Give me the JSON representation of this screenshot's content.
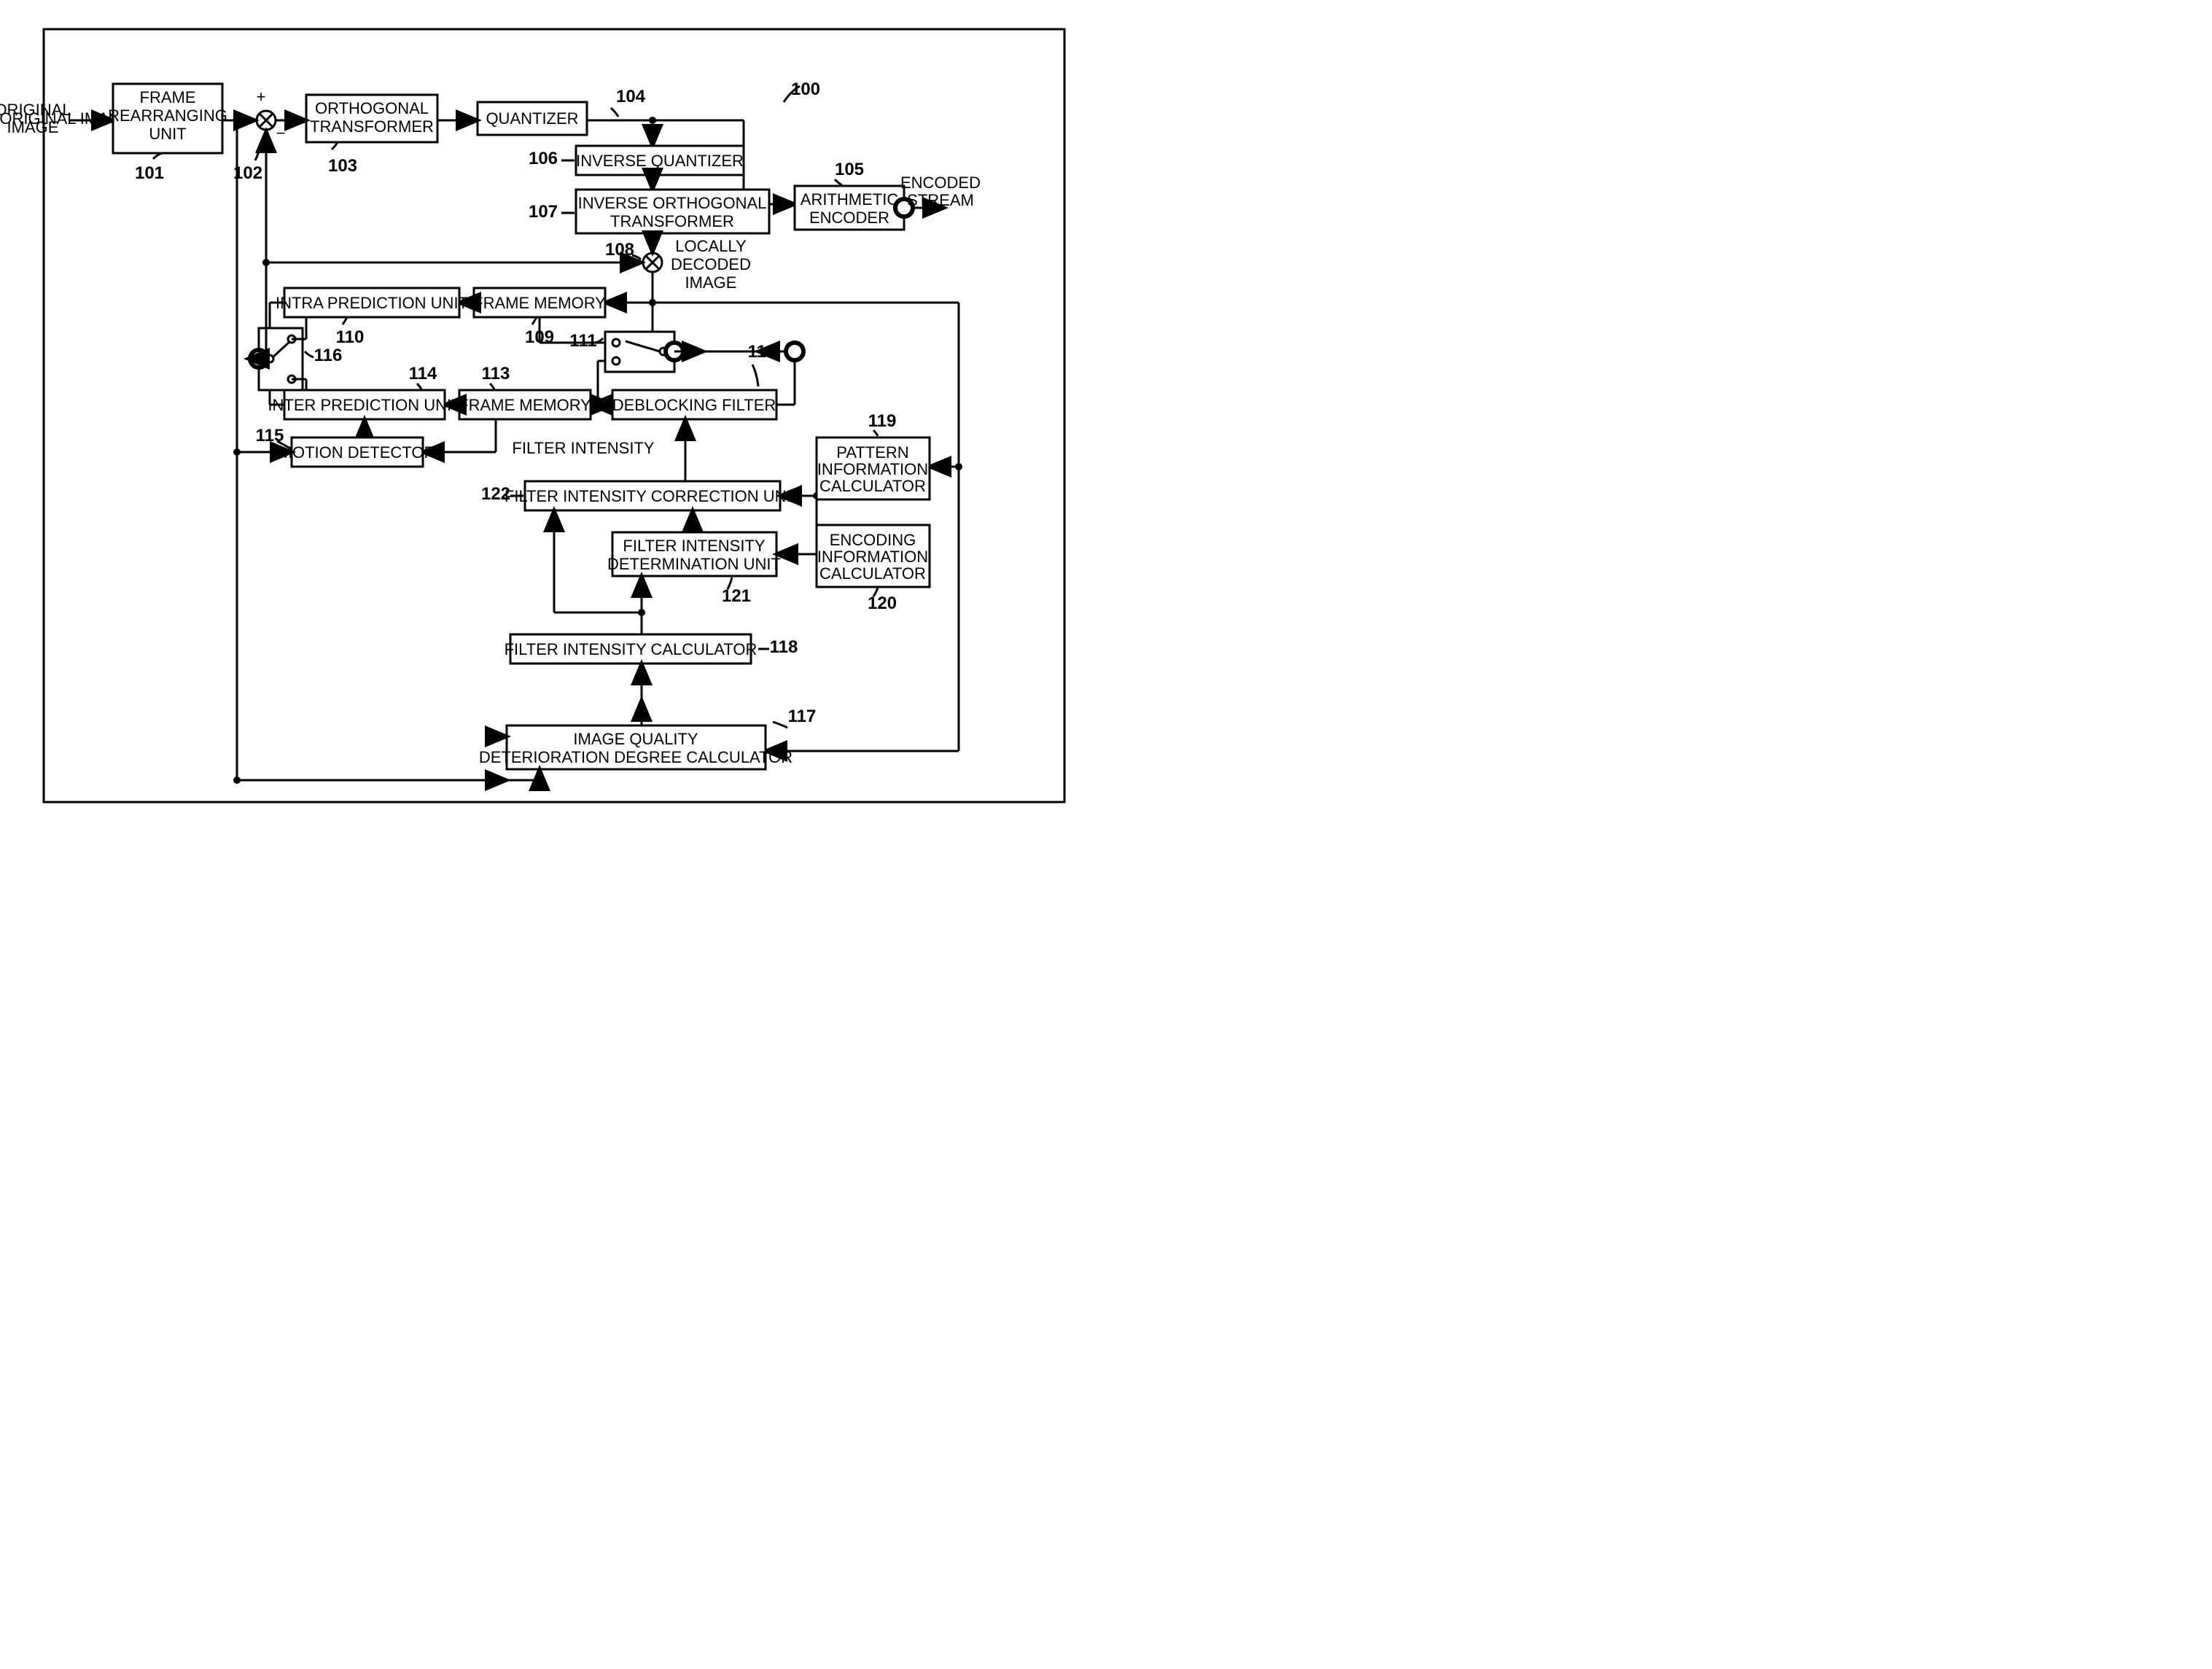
{
  "diagram_ref": "100",
  "io": {
    "in": "ORIGINAL IMAGE",
    "out": "ENCODED STREAM",
    "local": "LOCALLY DECODED IMAGE",
    "filt": "FILTER INTENSITY"
  },
  "blocks": {
    "b101": {
      "ref": "101",
      "lines": [
        "FRAME",
        "REARRANGING",
        "UNIT"
      ]
    },
    "b102": {
      "ref": "102"
    },
    "b103": {
      "ref": "103",
      "lines": [
        "ORTHOGONAL",
        "TRANSFORMER"
      ]
    },
    "b104": {
      "ref": "104",
      "lines": [
        "QUANTIZER"
      ]
    },
    "b105": {
      "ref": "105",
      "lines": [
        "ARITHMETIC",
        "ENCODER"
      ]
    },
    "b106": {
      "ref": "106",
      "lines": [
        "INVERSE QUANTIZER"
      ]
    },
    "b107": {
      "ref": "107",
      "lines": [
        "INVERSE ORTHOGONAL",
        "TRANSFORMER"
      ]
    },
    "b108": {
      "ref": "108"
    },
    "b109": {
      "ref": "109",
      "lines": [
        "FRAME MEMORY"
      ]
    },
    "b110": {
      "ref": "110",
      "lines": [
        "INTRA PREDICTION UNIT"
      ]
    },
    "b111": {
      "ref": "111"
    },
    "b112": {
      "ref": "112",
      "lines": [
        "DEBLOCKING FILTER"
      ]
    },
    "b113": {
      "ref": "113",
      "lines": [
        "FRAME MEMORY"
      ]
    },
    "b114": {
      "ref": "114",
      "lines": [
        "INTER PREDICTION UNIT"
      ]
    },
    "b115": {
      "ref": "115",
      "lines": [
        "MOTION DETECTOR"
      ]
    },
    "b116": {
      "ref": "116"
    },
    "b117": {
      "ref": "117",
      "lines": [
        "IMAGE QUALITY",
        "DETERIORATION DEGREE CALCULATOR"
      ]
    },
    "b118": {
      "ref": "118",
      "lines": [
        "FILTER INTENSITY CALCULATOR"
      ]
    },
    "b119": {
      "ref": "119",
      "lines": [
        "PATTERN",
        "INFORMATION",
        "CALCULATOR"
      ]
    },
    "b120": {
      "ref": "120",
      "lines": [
        "ENCODING",
        "INFORMATION",
        "CALCULATOR"
      ]
    },
    "b121": {
      "ref": "121",
      "lines": [
        "FILTER INTENSITY",
        "DETERMINATION UNIT"
      ]
    },
    "b122": {
      "ref": "122",
      "lines": [
        "FILTER INTENSITY CORRECTION UNIT"
      ]
    }
  }
}
